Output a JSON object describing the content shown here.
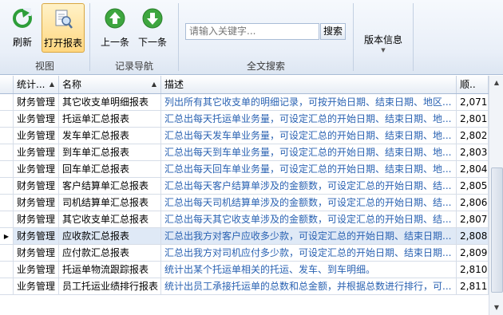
{
  "ribbon": {
    "groups": [
      {
        "label": "视图",
        "buttons": [
          {
            "label": "刷新",
            "icon": "refresh-icon"
          },
          {
            "label": "打开报表",
            "icon": "open-report-icon"
          }
        ]
      },
      {
        "label": "记录导航",
        "buttons": [
          {
            "label": "上一条",
            "icon": "arrow-up-icon"
          },
          {
            "label": "下一条",
            "icon": "arrow-down-icon"
          }
        ]
      },
      {
        "label": "全文搜索",
        "search_placeholder": "请输入关键字...",
        "search_button": "搜索"
      },
      {
        "label": "",
        "button": "版本信息"
      }
    ]
  },
  "grid": {
    "columns": [
      "统计...",
      "名称",
      "描述",
      "顺.."
    ],
    "rows": [
      {
        "cat": "财务管理",
        "name": "其它收支单明细报表",
        "desc": "列出所有其它收支单的明细记录，可按开始日期、结束日期、地区...",
        "num": "2,071"
      },
      {
        "cat": "业务管理",
        "name": "托运单汇总报表",
        "desc": "汇总出每天托运单业务量，可设定汇总的开始日期、结束日期、地...",
        "num": "2,801"
      },
      {
        "cat": "业务管理",
        "name": "发车单汇总报表",
        "desc": "汇总出每天发车单业务量，可设定汇总的开始日期、结束日期、地...",
        "num": "2,802"
      },
      {
        "cat": "业务管理",
        "name": "到车单汇总报表",
        "desc": "汇总出每天到车单业务量，可设定汇总的开始日期、结束日期、地...",
        "num": "2,803"
      },
      {
        "cat": "业务管理",
        "name": "回车单汇总报表",
        "desc": "汇总出每天回车单业务量，可设定汇总的开始日期、结束日期、地...",
        "num": "2,804"
      },
      {
        "cat": "财务管理",
        "name": "客户结算单汇总报表",
        "desc": "汇总出每天客户结算单涉及的金额数，可设定汇总的开始日期、结...",
        "num": "2,805"
      },
      {
        "cat": "财务管理",
        "name": "司机结算单汇总报表",
        "desc": "汇总出每天司机结算单涉及的金额数，可设定汇总的开始日期、结...",
        "num": "2,806"
      },
      {
        "cat": "财务管理",
        "name": "其它收支单汇总报表",
        "desc": "汇总出每天其它收支单涉及的金额数，可设定汇总的开始日期、结...",
        "num": "2,807"
      },
      {
        "cat": "财务管理",
        "name": "应收款汇总报表",
        "desc": "汇总出我方对客户应收多少款，可设定汇总的开始日期、结束日期...",
        "num": "2,808"
      },
      {
        "cat": "财务管理",
        "name": "应付款汇总报表",
        "desc": "汇总出我方对司机应付多少款，可设定汇总的开始日期、结束日期...",
        "num": "2,809"
      },
      {
        "cat": "业务管理",
        "name": "托运单物流跟踪报表",
        "desc": "统计出某个托运单相关的托运、发车、到车明细。",
        "num": "2,810"
      },
      {
        "cat": "业务管理",
        "name": "员工托运业绩排行报表",
        "desc": "统计出员工承接托运单的总数和总金额，并根据总数进行排行，可...",
        "num": "2,811"
      }
    ],
    "selected_row": 8
  }
}
